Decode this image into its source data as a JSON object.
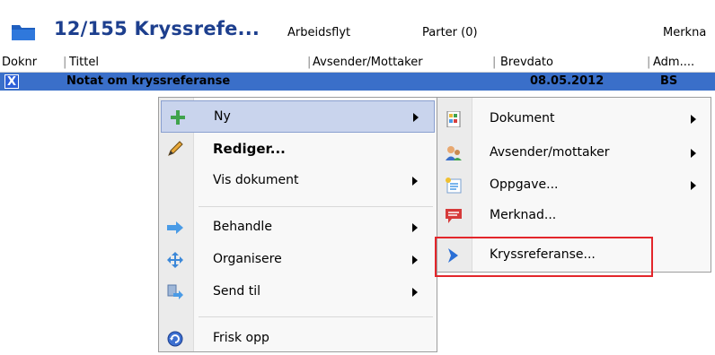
{
  "header": {
    "title": "12/155 Kryssrefe...",
    "tabs": [
      "Arbeidsflyt",
      "Parter (0)",
      "Merkna"
    ]
  },
  "columns": [
    "Doknr",
    "Tittel",
    "Avsender/Mottaker",
    "Brevdato",
    "Adm...."
  ],
  "row": {
    "type_badge": "X",
    "title": "Notat om kryssreferanse",
    "date": "08.05.2012",
    "adm": "BS"
  },
  "context_menu": {
    "items": [
      {
        "label": "Ny",
        "icon": "add-icon",
        "submenu": true,
        "highlighted": true
      },
      {
        "label": "Rediger...",
        "icon": "pencil-icon",
        "submenu": false,
        "bold": true
      },
      {
        "label": "Vis dokument",
        "icon": "",
        "submenu": true
      },
      {
        "label": "Behandle",
        "icon": "process-arrow-icon",
        "submenu": true
      },
      {
        "label": "Organisere",
        "icon": "move-icon",
        "submenu": true
      },
      {
        "label": "Send til",
        "icon": "send-icon",
        "submenu": true
      },
      {
        "label": "Frisk opp",
        "icon": "refresh-icon",
        "submenu": false
      }
    ]
  },
  "submenu": {
    "items": [
      {
        "label": "Dokument",
        "icon": "document-icon",
        "submenu": true
      },
      {
        "label": "Avsender/mottaker",
        "icon": "contacts-icon",
        "submenu": true
      },
      {
        "label": "Oppgave...",
        "icon": "task-icon",
        "submenu": true
      },
      {
        "label": "Merknad...",
        "icon": "comment-icon",
        "submenu": false
      },
      {
        "label": "Kryssreferanse...",
        "icon": "chevron-right-icon",
        "submenu": false,
        "outlined": true
      }
    ]
  },
  "colors": {
    "title": "#1d3f8e",
    "row_selected": "#3a6fc9",
    "highlight": "#c9d4ed",
    "outline": "#e3262b"
  }
}
